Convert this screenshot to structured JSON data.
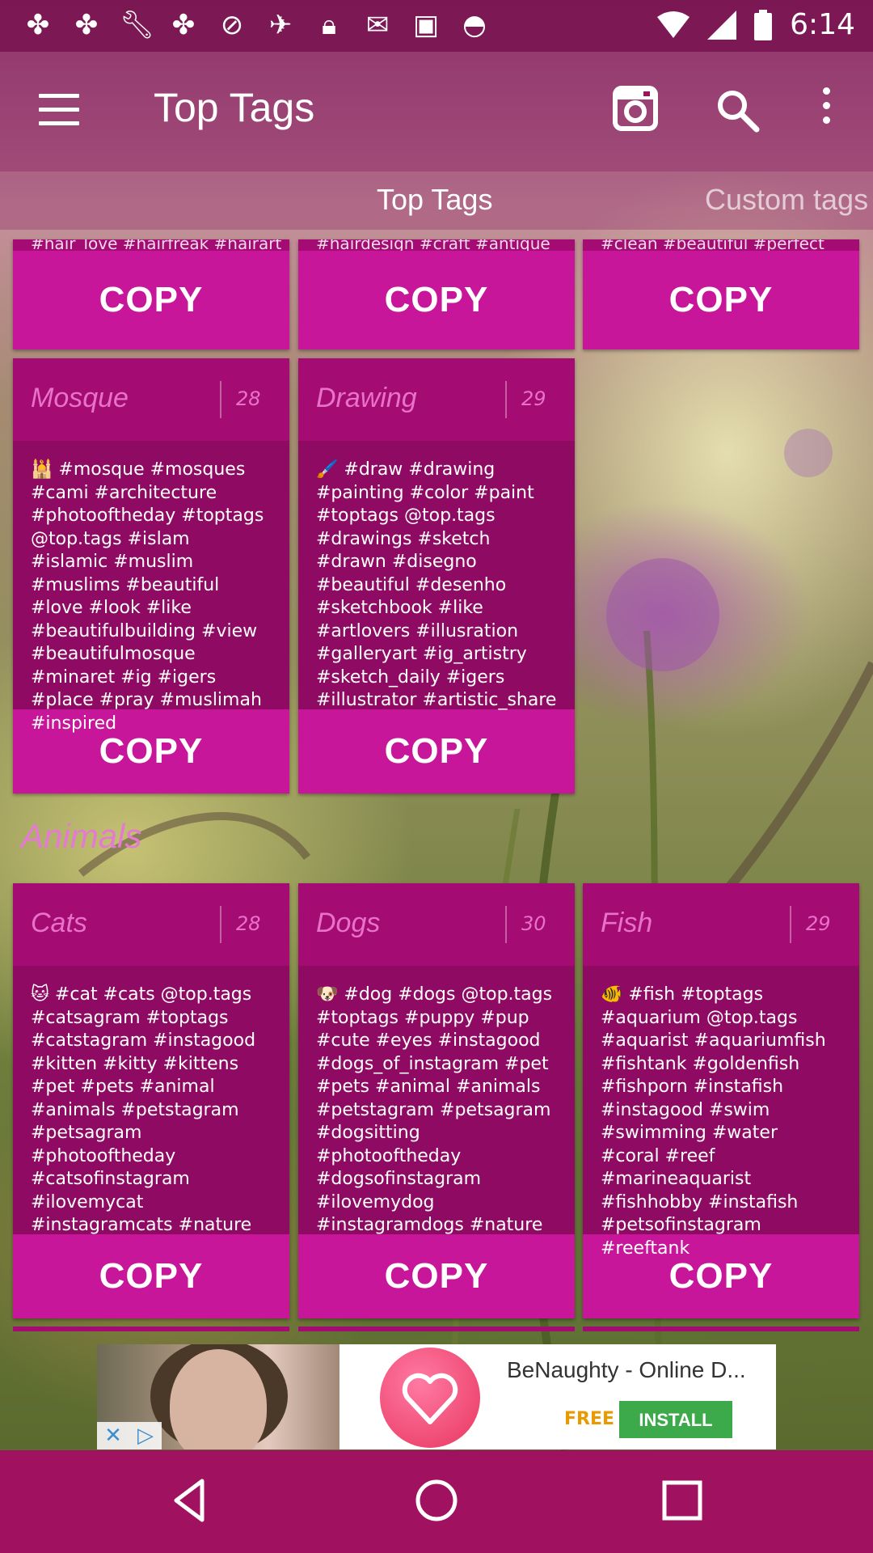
{
  "status_bar": {
    "time": "6:14",
    "icons": [
      "pinwheel-icon",
      "pinwheel-icon",
      "wrench-icon",
      "pinwheel-icon",
      "block-icon",
      "satellite-icon",
      "lock-icon",
      "mail-check-icon",
      "briefcase-icon",
      "android-icon"
    ]
  },
  "toolbar": {
    "title": "Top Tags"
  },
  "tabs": [
    {
      "label": "Top Tags",
      "active": true
    },
    {
      "label": "Custom tags",
      "active": false
    }
  ],
  "top_partial_cards": [
    {
      "text": "#hair_love #hairfreak #hairart",
      "copy": "COPY"
    },
    {
      "text": "#hairdesign #craft #antique",
      "copy": "COPY"
    },
    {
      "text": "#clean #beautiful #perfect",
      "copy": "COPY"
    }
  ],
  "cards_row1": [
    {
      "name": "Mosque",
      "count": "28",
      "tags": "🕌 #mosque #mosques #cami #architecture #photooftheday #toptags @top.tags #islam #islamic #muslim #muslims #beautiful #love #look #like #beautifulbuilding #view #beautifulmosque #minaret #ig #igers #place #pray #muslimah #inspired",
      "copy": "COPY"
    },
    {
      "name": "Drawing",
      "count": "29",
      "tags": "🖌️ #draw #drawing #painting #color #paint #toptags @top.tags #drawings #sketch #drawn #disegno #beautiful #desenho #sketchbook #like #artlovers #illusration #galleryart #ig_artistry #sketch_daily #igers #illustrator #artistic_share",
      "copy": "COPY"
    }
  ],
  "section": {
    "title": "Animals"
  },
  "cards_row2": [
    {
      "name": "Cats",
      "count": "28",
      "tags": "🐱 #cat #cats @top.tags #catsagram #toptags #catstagram #instagood #kitten #kitty #kittens #pet #pets #animal #animals #petstagram #petsagram #photooftheday #catsofinstagram #ilovemycat #instagramcats #nature",
      "copy": "COPY"
    },
    {
      "name": "Dogs",
      "count": "30",
      "tags": "🐶 #dog #dogs @top.tags #toptags #puppy #pup #cute #eyes #instagood #dogs_of_instagram #pet #pets #animal #animals #petstagram #petsagram #dogsitting #photooftheday #dogsofinstagram #ilovemydog #instagramdogs #nature",
      "copy": "COPY"
    },
    {
      "name": "Fish",
      "count": "29",
      "tags": "🐠 #fish #toptags #aquarium @top.tags #aquarist #aquariumfish #fishtank #goldenfish #fishporn #instafish #instagood #swim #swimming #water #coral #reef #marineaquarist #fishhobby #instafish #petsofinstagram #reeftank",
      "copy": "COPY"
    }
  ],
  "ad": {
    "title": "BeNaughty - Online D...",
    "free": "FREE",
    "install": "INSTALL"
  },
  "colors": {
    "card": "#a40c73",
    "card_body": "#8f0a63",
    "copy_button": "#c7169a",
    "accent_text": "#e872c9",
    "nav_bar": "#a0125f"
  }
}
